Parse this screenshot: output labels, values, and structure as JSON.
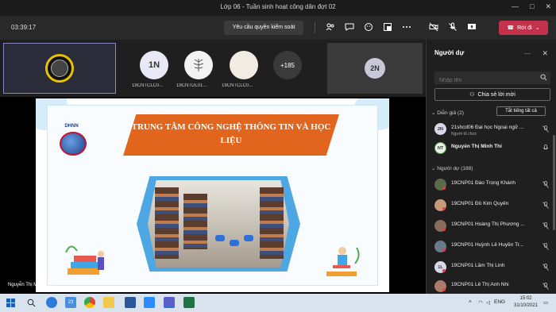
{
  "window": {
    "title": "Lớp 06 - Tuần sinh hoạt công dân đợt 02",
    "controls": [
      "—",
      "□",
      "✕"
    ]
  },
  "toolbar": {
    "timer": "03:39:17",
    "request_control_label": "Yêu cầu quyền kiểm soát",
    "leave_label": "Rời đi",
    "leave_color": "#c4314b"
  },
  "strip": {
    "tiles": [
      {
        "initials": "1N",
        "name": "19CNTCLC0..."
      },
      {
        "initials": "",
        "name": "19CNTDL01..."
      },
      {
        "initials": "",
        "name": "19CNTCLC0..."
      }
    ],
    "more_count": "+185",
    "side_initials": "2N"
  },
  "slide": {
    "title": "TRUNG TÂM CÔNG NGHỆ THÔNG TIN VÀ HỌC LIỆU",
    "logo_text": "DHNN",
    "title_color": "#e1651d"
  },
  "stage": {
    "presenter_name": "Nguyễn Thị Minh Thi"
  },
  "panel": {
    "title": "Người dự",
    "search_placeholder": "Nhập tên",
    "share_invite_label": "Chia sẻ lời mời",
    "presenters_header": "Diễn giả (2)",
    "mute_all_label": "Tắt tiếng tất cả",
    "presenters": [
      {
        "initials": "2N",
        "name": "21shcd06 Đại học Ngoại ngữ ...",
        "role": "Người tổ chức"
      },
      {
        "initials": "NT",
        "name": "Nguyễn Thị Minh Thi",
        "role": ""
      }
    ],
    "attendees_header": "Người dự (188)",
    "attendees": [
      {
        "initials": "",
        "name": "19CNP01 Đào Trọng Khánh"
      },
      {
        "initials": "",
        "name": "19CNP01 Đỗ Kim Quyên"
      },
      {
        "initials": "",
        "name": "19CNP01 Hoàng Thị Phương ..."
      },
      {
        "initials": "",
        "name": "19CNP01 Huỳnh Lê Huyền Tr..."
      },
      {
        "initials": "1L",
        "name": "19CNP01 Lâm Thị Linh"
      },
      {
        "initials": "",
        "name": "19CNP01 Lê Thị Anh Nhi"
      }
    ]
  },
  "taskbar": {
    "badge": "23",
    "language": "ENG",
    "time": "15:02",
    "date": "31/10/2021"
  }
}
